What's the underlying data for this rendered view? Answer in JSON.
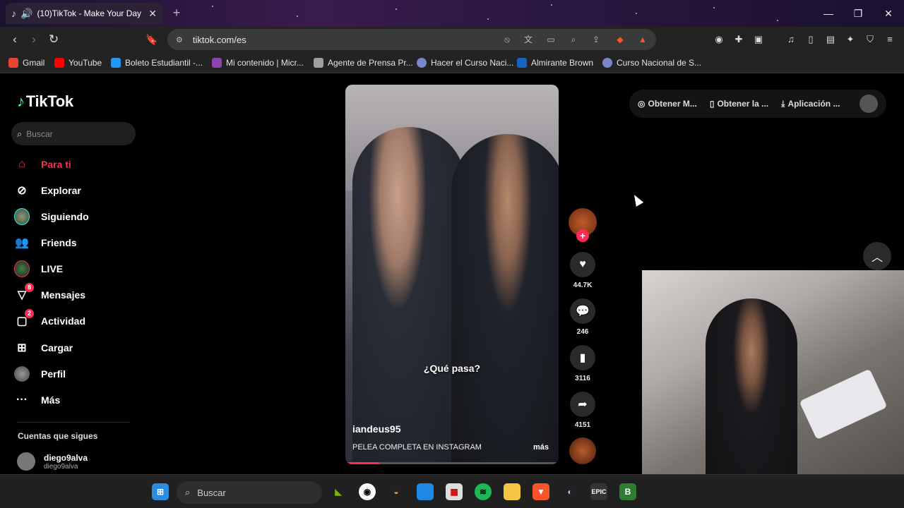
{
  "browser": {
    "tab_title": "(10)TikTok - Make Your Day",
    "url": "tiktok.com/es"
  },
  "bookmarks": [
    {
      "label": "Gmail",
      "color": "#ea4335"
    },
    {
      "label": "YouTube",
      "color": "#ff0000"
    },
    {
      "label": "Boleto Estudiantil -...",
      "color": "#2196f3"
    },
    {
      "label": "Mi contenido | Micr...",
      "color": "#8e44ad"
    },
    {
      "label": "Agente de Prensa Pr...",
      "color": "#9e9e9e"
    },
    {
      "label": "Hacer el Curso Naci...",
      "color": "#7986cb"
    },
    {
      "label": "Almirante Brown",
      "color": "#1565c0"
    },
    {
      "label": "Curso Nacional de S...",
      "color": "#7986cb"
    }
  ],
  "tiktok": {
    "logo": "TikTok",
    "search_placeholder": "Buscar",
    "nav": [
      {
        "label": "Para ti",
        "icon": "home-icon",
        "active": true
      },
      {
        "label": "Explorar",
        "icon": "compass-icon"
      },
      {
        "label": "Siguiendo",
        "icon": "following-icon"
      },
      {
        "label": "Friends",
        "icon": "friends-icon"
      },
      {
        "label": "LIVE",
        "icon": "live-icon"
      },
      {
        "label": "Mensajes",
        "icon": "messages-icon",
        "badge": "8"
      },
      {
        "label": "Actividad",
        "icon": "activity-icon",
        "badge": "2"
      },
      {
        "label": "Cargar",
        "icon": "upload-icon"
      },
      {
        "label": "Perfil",
        "icon": "profile-icon"
      },
      {
        "label": "Más",
        "icon": "more-icon"
      }
    ],
    "following_title": "Cuentas que sigues",
    "following_account": {
      "name": "diego9alva",
      "handle": "diego9alva"
    },
    "top_actions": [
      "Obtener M...",
      "Obtener la ...",
      "Aplicación ..."
    ],
    "video": {
      "overlay_text": "¿Qué pasa?",
      "username": "iandeus95",
      "description": "PELEA COMPLETA EN INSTAGRAM",
      "more": "más",
      "progress": 0.16
    },
    "actions": {
      "likes": "44.7K",
      "comments": "246",
      "saves": "3116",
      "shares": "4151"
    },
    "accent": "#fe2c55"
  },
  "taskbar": {
    "search_label": "Buscar"
  }
}
